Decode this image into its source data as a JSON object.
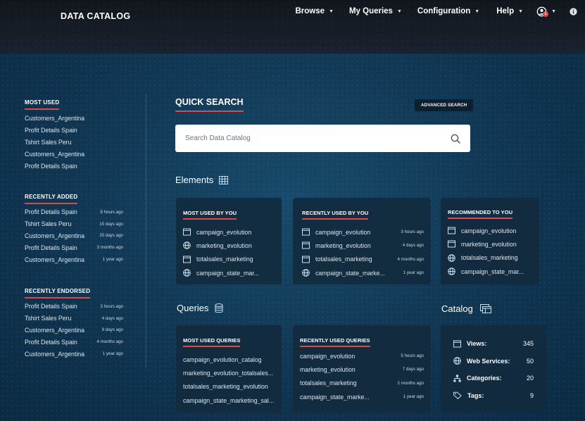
{
  "header": {
    "logo_text": "DATA CATALOG",
    "nav": [
      {
        "label": "Browse"
      },
      {
        "label": "My Queries"
      },
      {
        "label": "Configuration"
      },
      {
        "label": "Help"
      }
    ],
    "user_badge_count": "1"
  },
  "sidebar": {
    "most_used": {
      "title": "MOST USED",
      "items": [
        "Customers_Argentina",
        "Profit Details Spain",
        "Tshirt Sales Peru",
        "Customers_Argentina",
        "Profit Details Spain"
      ]
    },
    "recently_added": {
      "title": "RECENTLY ADDED",
      "items": [
        {
          "name": "Profit Details Spain",
          "time": "8 hours ago"
        },
        {
          "name": "Tshirt Sales Peru",
          "time": "15 days ago"
        },
        {
          "name": "Customers_Argentina",
          "time": "20 days ago"
        },
        {
          "name": "Profit Details Spain",
          "time": "3 months ago"
        },
        {
          "name": "Customers_Argentina",
          "time": "1 year ago"
        }
      ]
    },
    "recently_endorsed": {
      "title": "RECENTLY ENDORSED",
      "items": [
        {
          "name": "Profit Details Spain",
          "time": "3 hours ago"
        },
        {
          "name": "Tshirt Sales Peru",
          "time": "4 days ago"
        },
        {
          "name": "Customers_Argentina",
          "time": "9 days ago"
        },
        {
          "name": "Profit Details Spain",
          "time": "4 months ago"
        },
        {
          "name": "Customers_Argentina",
          "time": "1 year ago"
        }
      ]
    }
  },
  "quick_search": {
    "title": "QUICK SEARCH",
    "advanced_label": "ADVANCED SEARCH",
    "placeholder": "Search Data Catalog"
  },
  "elements": {
    "title": "Elements",
    "most_used_by_you": {
      "title": "MOST USED BY YOU",
      "items": [
        {
          "icon": "view-icon",
          "name": "campaign_evolution"
        },
        {
          "icon": "globe-icon",
          "name": "marketing_evolution"
        },
        {
          "icon": "view-icon",
          "name": "totalsales_marketing"
        },
        {
          "icon": "globe-icon",
          "name": "campaign_state_mar..."
        }
      ]
    },
    "recently_used_by_you": {
      "title": "RECENTLY USED BY YOU",
      "items": [
        {
          "icon": "view-icon",
          "name": "campaign_evolution",
          "time": "3 hours ago"
        },
        {
          "icon": "view-icon",
          "name": "marketing_evolution",
          "time": "4 days ago"
        },
        {
          "icon": "view-icon",
          "name": "totalsales_marketing",
          "time": "4 months ago"
        },
        {
          "icon": "globe-icon",
          "name": "campaign_state_marke...",
          "time": "1 year ago"
        }
      ]
    },
    "recommended_to_you": {
      "title": "RECOMMENDED TO YOU",
      "items": [
        {
          "icon": "view-icon",
          "name": "campaign_evolution"
        },
        {
          "icon": "view-icon",
          "name": "marketing_evolution"
        },
        {
          "icon": "globe-icon",
          "name": "totalsales_marketing"
        },
        {
          "icon": "globe-icon",
          "name": "campaign_state_mar..."
        }
      ]
    }
  },
  "queries": {
    "title": "Queries",
    "most_used": {
      "title": "MOST USED QUERIES",
      "items": [
        "campaign_evolution_catalog",
        "marketing_evolution_totalsales...",
        "totalsales_marketing_evolution",
        "campaign_state_marketing_sal..."
      ]
    },
    "recently_used": {
      "title": "RECENTLY USED QUERIES",
      "items": [
        {
          "name": "campaign_evolution",
          "time": "5 hours ago"
        },
        {
          "name": "marketing_evolution",
          "time": "7 days ago"
        },
        {
          "name": "totalsales_marketing",
          "time": "2 months ago"
        },
        {
          "name": "campaign_state_marke...",
          "time": "1 year ago"
        }
      ]
    }
  },
  "catalog": {
    "title": "Catalog",
    "stats": [
      {
        "icon": "view-icon",
        "label": "Views:",
        "value": "345"
      },
      {
        "icon": "globe-icon",
        "label": "Web Services:",
        "value": "50"
      },
      {
        "icon": "hierarchy-icon",
        "label": "Categories:",
        "value": "20"
      },
      {
        "icon": "tag-icon",
        "label": "Tags:",
        "value": "9"
      }
    ]
  }
}
